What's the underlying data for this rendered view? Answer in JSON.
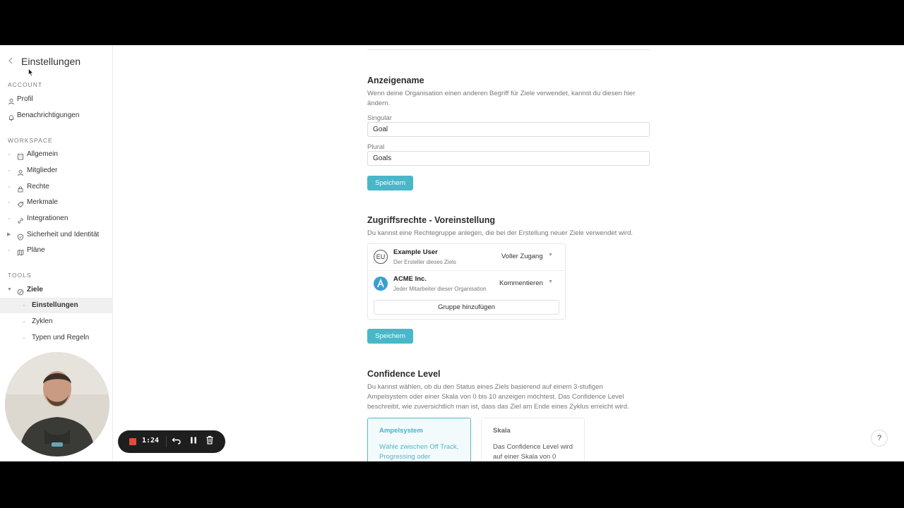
{
  "sidebar": {
    "title": "Einstellungen",
    "account_heading": "ACCOUNT",
    "account_items": [
      {
        "label": "Profil",
        "icon": "person-icon"
      },
      {
        "label": "Benachrichtigungen",
        "icon": "bell-icon"
      }
    ],
    "workspace_heading": "WORKSPACE",
    "workspace_items": [
      {
        "label": "Allgemein",
        "icon": "building-icon"
      },
      {
        "label": "Mitglieder",
        "icon": "person-icon"
      },
      {
        "label": "Rechte",
        "icon": "lock-icon"
      },
      {
        "label": "Merkmale",
        "icon": "tag-icon"
      },
      {
        "label": "Integrationen",
        "icon": "link-icon"
      },
      {
        "label": "Sicherheit und Identität",
        "icon": "shield-icon"
      },
      {
        "label": "Pläne",
        "icon": "map-icon"
      }
    ],
    "tools_heading": "TOOLS",
    "tools_item": {
      "label": "Ziele",
      "icon": "target-icon"
    },
    "tools_subitems": [
      {
        "label": "Einstellungen",
        "active": true
      },
      {
        "label": "Zyklen",
        "active": false
      },
      {
        "label": "Typen und Regeln",
        "active": false
      }
    ]
  },
  "display_name": {
    "heading": "Anzeigename",
    "description": "Wenn deine Organisation einen anderen Begriff für Ziele verwendet, kannst du diesen hier ändern.",
    "singular_label": "Singular",
    "singular_value": "Goal",
    "plural_label": "Plural",
    "plural_value": "Goals",
    "save_label": "Speichern"
  },
  "access": {
    "heading": "Zugriffsrechte - Voreinstellung",
    "description": "Du kannst eine Rechtegruppe anlegen, die bei der Erstellung neuer Ziele verwendet wird.",
    "rows": [
      {
        "avatar": "EU",
        "name": "Example User",
        "sub": "Der Ersteller dieses Ziels",
        "role": "Voller Zugang"
      },
      {
        "avatar": "",
        "name": "ACME Inc.",
        "sub": "Jeder Mitarbeiter dieser Organisation",
        "role": "Kommentieren"
      }
    ],
    "add_group_label": "Gruppe hinzufügen",
    "save_label": "Speichern"
  },
  "confidence": {
    "heading": "Confidence Level",
    "description": "Du kannst wählen, ob du den Status eines Ziels basierend auf einem 3-stufigen Ampelsystem oder einer Skala von 0 bis 10 anzeigen möchtest. Das Confidence Level beschreibt, wie zuversichtlich man ist, dass das Ziel am Ende eines Zyklus erreicht wird.",
    "options": [
      {
        "title": "Ampelsystem",
        "desc": "Wähle zwischen Off Track, Progressing oder",
        "selected": true
      },
      {
        "title": "Skala",
        "desc": "Das Confidence Level wird auf einer Skala von 0",
        "selected": false
      }
    ]
  },
  "help_label": "?",
  "recorder": {
    "time": "1:24"
  },
  "colors": {
    "accent": "#4ab7c9",
    "record": "#e24a3b"
  }
}
